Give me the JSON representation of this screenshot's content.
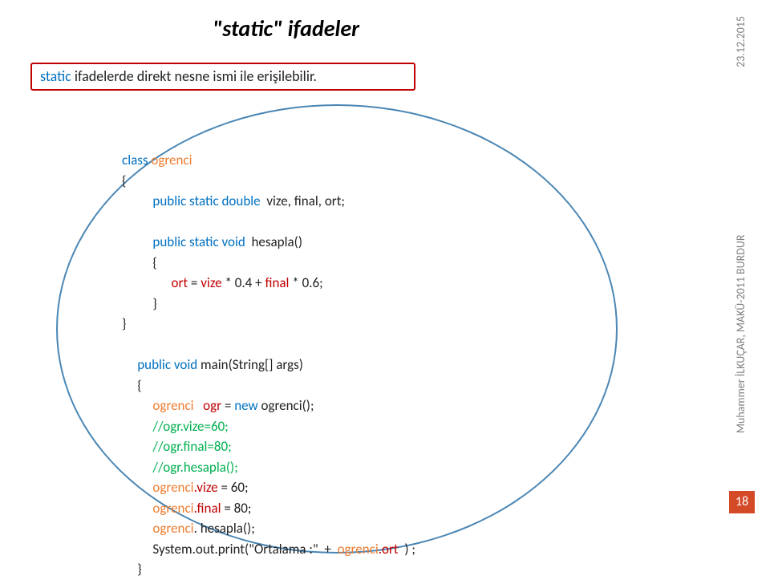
{
  "title": "\"static\" ifadeler",
  "subtitle": {
    "kw": "static",
    "rest": "  ifadelerde direkt nesne ismi ile  erişilebilir."
  },
  "date": "23.12.2015",
  "footer": "Muhammer İLKUÇAR, MAKÜ-2011 BURDUR",
  "page": "18",
  "code": {
    "l1a": "class ",
    "l1b": "ogrenci",
    "l2": "{",
    "l3a": "          public static double  ",
    "l3b": "vize, final, ort;",
    "l4": "",
    "l5a": "          public static void  ",
    "l5b": "hesapla()",
    "l6": "          {",
    "l7a": "                ort ",
    "l7b": "= ",
    "l7c": "vize ",
    "l7d": "* 0.4 + ",
    "l7e": "final ",
    "l7f": "* 0.6;",
    "l8": "          }",
    "l9": "}",
    "l10": "",
    "l11a": "     public void ",
    "l11b": "main(String[] args)",
    "l12": "     {",
    "l13a": "          ogrenci   ",
    "l13b": "ogr ",
    "l13c": "= ",
    "l13d": "new ",
    "l13e": "ogrenci();",
    "l14": "          //ogr.vize=60;",
    "l15": "          //ogr.final=80;",
    "l16": "          //ogr.hesapla();",
    "l17a": "          ogrenci",
    "l17b": ".vize ",
    "l17c": "= 60;",
    "l18a": "          ogrenci",
    "l18b": ".final ",
    "l18c": "= 80;",
    "l19a": "          ogrenci",
    "l19b": ". hesapla();",
    "l20a": "          System.out.print(\"Ortalama :\"  +  ",
    "l20b": "ogrenci",
    "l20c": ".ort  ",
    "l20d": ") ;",
    "l21": "     }"
  }
}
